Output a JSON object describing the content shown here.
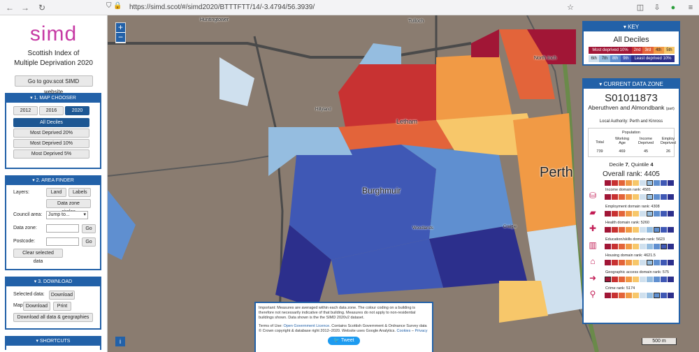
{
  "browser": {
    "url": "https://simd.scot/#/simd2020/BTTTFTT/14/-3.4794/56.3939/"
  },
  "sidebar": {
    "logo": "simd",
    "title_lines": [
      "Scottish Index of",
      "Multiple Deprivation 2020"
    ],
    "go_button": "Go to gov.scot SIMD website",
    "map_chooser": {
      "header": "1. MAP CHOOSER",
      "years": [
        "2012",
        "2016",
        "2020"
      ],
      "options": [
        "All Deciles",
        "Most Deprived 20%",
        "Most Deprived 10%",
        "Most Deprived 5%"
      ]
    },
    "area_finder": {
      "header": "2. AREA FINDER",
      "layers_label": "Layers:",
      "land": "Land",
      "labels": "Labels",
      "circles": "Data zone circles",
      "council_label": "Council area:",
      "council_value": "Jump to...",
      "dz_label": "Data zone:",
      "pc_label": "Postcode:",
      "go": "Go",
      "clear": "Clear selected data"
    },
    "download": {
      "header": "3. DOWNLOAD",
      "selected_label": "Selected data:",
      "download": "Download",
      "map_label": "Map:",
      "print": "Print",
      "all": "Download all data & geographies"
    },
    "shortcuts": "SHORTCUTS"
  },
  "map": {
    "labels": {
      "huntingtower": "Huntingtower",
      "tulloch": "Tulloch",
      "north_inch": "North Inch",
      "hillyland": "Hillyland",
      "letham": "Letham",
      "burghmuir": "Burghmuir",
      "perth": "Perth",
      "woodlands": "Woodlands",
      "craigie": "Craigie",
      "scale": "500 m"
    },
    "note": {
      "p1": "Important: Measures are averaged within each data zone. The colour coding on a building is therefore not necessarily indicative of that building. Measures do not apply to non-residential buildings shown. Data shown is the the SIMD 2020v2 dataset.",
      "p2a": "Terms of Use: ",
      "ogl": "Open Government Licence",
      "p2b": ". Contains Scottish Government & Ordnance Survey data © Crown copyright & database right 2012–2020. Website uses Google Analytics. ",
      "cookies": "Cookies",
      "sep": " – ",
      "privacy": "Privacy",
      "tweet": "Tweet"
    }
  },
  "key": {
    "header": "KEY",
    "title": "All Deciles",
    "most": "Most deprived 10%",
    "least": "Least deprived 10%",
    "d2": "2nd",
    "d3": "3rd",
    "d4": "4th",
    "d5": "5th",
    "d6": "6th",
    "d7": "7th",
    "d8": "8th",
    "d9": "9th",
    "colors": [
      "#a11636",
      "#c83232",
      "#e3643a",
      "#f19a45",
      "#f7c76a",
      "#cfe0ee",
      "#95bde0",
      "#5f8fd0",
      "#3f58b5",
      "#2c2f8c"
    ]
  },
  "data_zone": {
    "header": "CURRENT DATA ZONE",
    "code": "S01011873",
    "name": "Aberuthven and Almondbank",
    "part": "(part)",
    "local_authority": "Local Authority: Perth and Kinross",
    "population": {
      "title": "Population",
      "total_label": "Total",
      "working_label": "Working Age",
      "income_label": "Income Deprived",
      "employ_label": "Employ Deprived",
      "total": "739",
      "working": "469",
      "income": "45",
      "employ": "26"
    },
    "decile_pre": "Decile ",
    "decile": "7",
    "quintile_pre": ", Quintile ",
    "quintile": "4",
    "overall": "Overall rank: 4405",
    "overall_decile": 7,
    "domains": [
      {
        "icon": "coins-icon",
        "glyph": "⛁",
        "label": "Income domain rank: 4581",
        "decile": 7
      },
      {
        "icon": "briefcase-icon",
        "glyph": "▰",
        "label": "Employment domain rank: 4308",
        "decile": 7
      },
      {
        "icon": "health-cross-icon",
        "glyph": "✚",
        "label": "Health domain rank: 5260",
        "decile": 8
      },
      {
        "icon": "book-icon",
        "glyph": "▥",
        "label": "Education/skills domain rank: 5623",
        "decile": 9
      },
      {
        "icon": "house-icon",
        "glyph": "⌂",
        "label": "Housing domain rank: 4621.5",
        "decile": 7
      },
      {
        "icon": "signpost-icon",
        "glyph": "➜",
        "label": "Geographic access domain rank: 575",
        "decile": 1
      },
      {
        "icon": "handcuffs-icon",
        "glyph": "⚲",
        "label": "Crime rank: 5174",
        "decile": 8
      }
    ]
  }
}
